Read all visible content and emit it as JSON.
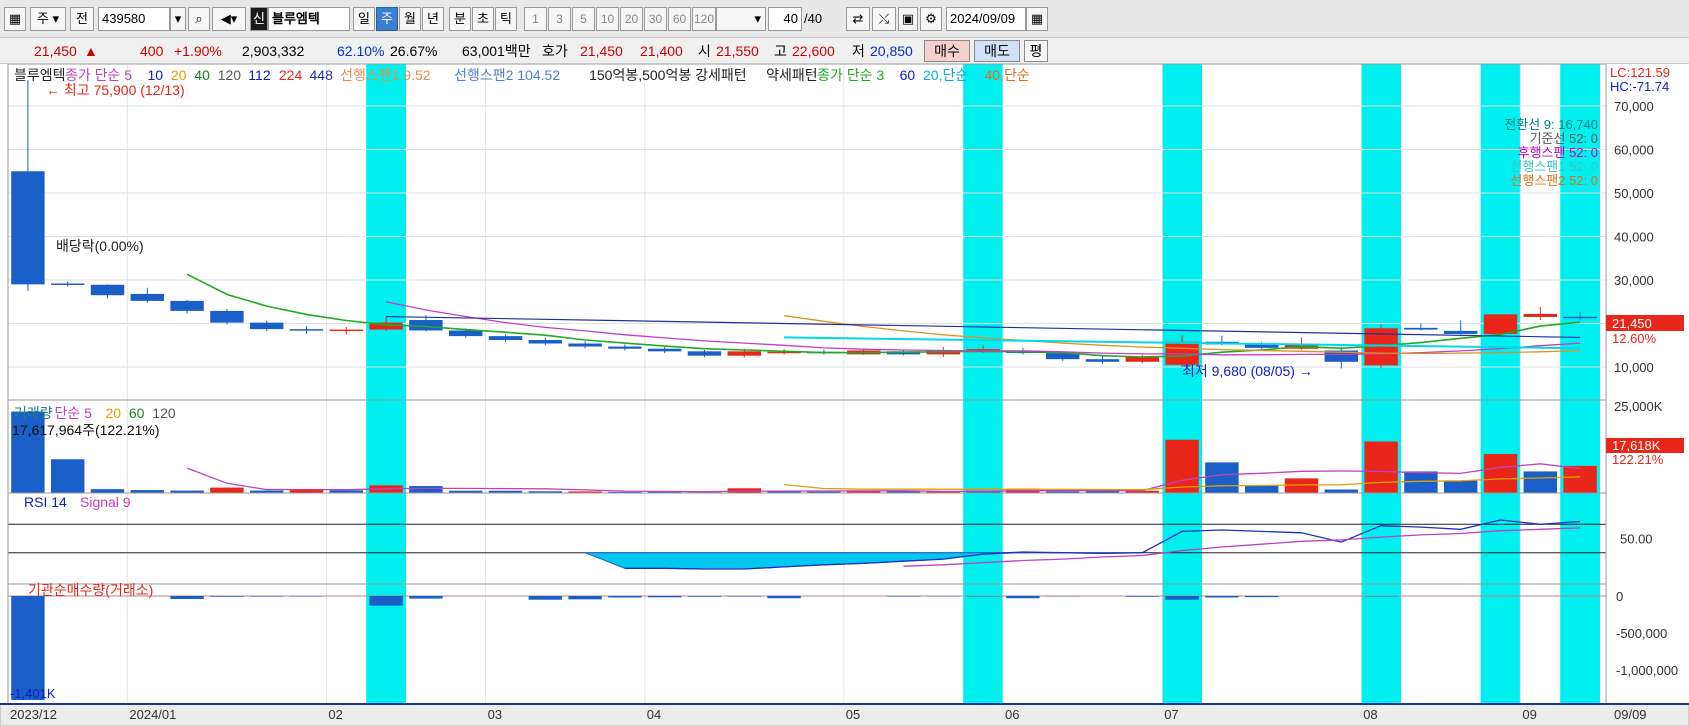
{
  "toolbar": {
    "period_selected": "주",
    "prev_label": "전",
    "stock_code": "439580",
    "stock_type_badge": "신",
    "stock_name": "블루엠텍",
    "day_label": "일",
    "week_label": "주",
    "month_label": "월",
    "year_label": "년",
    "minute_label": "분",
    "second_label": "초",
    "tick_label": "틱",
    "intervals": [
      "1",
      "3",
      "5",
      "10",
      "20",
      "30",
      "60",
      "120"
    ],
    "count_display": "40",
    "count_total": "/40",
    "date": "2024/09/09"
  },
  "quote": {
    "price": "21,450",
    "change": "400",
    "change_pct": "+1.90%",
    "volume": "2,903,332",
    "volume_pct": "62.10%",
    "turnover_pct": "26.67%",
    "value": "63,001백만",
    "ask_label": "호가",
    "ask": "21,450",
    "bid": "21,400",
    "open_label": "시",
    "open": "21,550",
    "high_label": "고",
    "high": "22,600",
    "low_label": "저",
    "low": "20,850",
    "buy_button": "매수",
    "sell_button": "매도",
    "eval_button": "평"
  },
  "chart_data": [
    {
      "type": "candlestick",
      "stock_name": "블루엠텍",
      "legend": [
        "블루엠텍",
        "종가 단순 5",
        "10",
        "20",
        "40",
        "120",
        "112",
        "224",
        "448",
        "선행스팬1 9.52",
        "선행스팬2 104.52",
        "150억봉,500억봉 강세패턴",
        "약세패턴",
        "종가 단순 3",
        "60",
        "20,단순",
        "40,단순"
      ],
      "candles": [
        {
          "date": "2023/12/11",
          "o": 55000,
          "h": 75900,
          "l": 27500,
          "c": 29000
        },
        {
          "date": "2023/12/18",
          "o": 29200,
          "h": 29600,
          "l": 28500,
          "c": 28900
        },
        {
          "date": "2023/12/25",
          "o": 28900,
          "h": 29000,
          "l": 25800,
          "c": 26500
        },
        {
          "date": "2024/01/01",
          "o": 26800,
          "h": 28200,
          "l": 24800,
          "c": 25200
        },
        {
          "date": "2024/01/08",
          "o": 25200,
          "h": 25400,
          "l": 22300,
          "c": 22900
        },
        {
          "date": "2024/01/15",
          "o": 22900,
          "h": 23300,
          "l": 19800,
          "c": 20200
        },
        {
          "date": "2024/01/22",
          "o": 20200,
          "h": 20600,
          "l": 18300,
          "c": 18700
        },
        {
          "date": "2024/01/29",
          "o": 18700,
          "h": 19400,
          "l": 17600,
          "c": 18600
        },
        {
          "date": "2024/02/05",
          "o": 18600,
          "h": 19200,
          "l": 17500,
          "c": 18600
        },
        {
          "date": "2024/02/13",
          "o": 18600,
          "h": 21600,
          "l": 18300,
          "c": 20200
        },
        {
          "date": "2024/02/19",
          "o": 20800,
          "h": 21900,
          "l": 18200,
          "c": 18400
        },
        {
          "date": "2024/02/26",
          "o": 18400,
          "h": 18900,
          "l": 16700,
          "c": 17100
        },
        {
          "date": "2024/03/04",
          "o": 17100,
          "h": 17500,
          "l": 15800,
          "c": 16200
        },
        {
          "date": "2024/03/11",
          "o": 16200,
          "h": 16700,
          "l": 15000,
          "c": 15400
        },
        {
          "date": "2024/03/18",
          "o": 15400,
          "h": 15900,
          "l": 14300,
          "c": 14700
        },
        {
          "date": "2024/03/25",
          "o": 14700,
          "h": 15200,
          "l": 13800,
          "c": 14200
        },
        {
          "date": "2024/04/01",
          "o": 14200,
          "h": 14600,
          "l": 13200,
          "c": 13600
        },
        {
          "date": "2024/04/08",
          "o": 13600,
          "h": 13900,
          "l": 12300,
          "c": 12600
        },
        {
          "date": "2024/04/15",
          "o": 12600,
          "h": 14200,
          "l": 12200,
          "c": 13600
        },
        {
          "date": "2024/04/22",
          "o": 13400,
          "h": 14100,
          "l": 12900,
          "c": 13500
        },
        {
          "date": "2024/04/29",
          "o": 13500,
          "h": 14000,
          "l": 12900,
          "c": 13200
        },
        {
          "date": "2024/05/06",
          "o": 12900,
          "h": 14200,
          "l": 12800,
          "c": 13800
        },
        {
          "date": "2024/05/13",
          "o": 13600,
          "h": 14000,
          "l": 12700,
          "c": 12900
        },
        {
          "date": "2024/05/20",
          "o": 12900,
          "h": 14600,
          "l": 12300,
          "c": 13900
        },
        {
          "date": "2024/05/27",
          "o": 13900,
          "h": 15000,
          "l": 13200,
          "c": 14100
        },
        {
          "date": "2024/06/03",
          "o": 13800,
          "h": 14400,
          "l": 12900,
          "c": 13200
        },
        {
          "date": "2024/06/10",
          "o": 13200,
          "h": 13600,
          "l": 11400,
          "c": 11800
        },
        {
          "date": "2024/06/17",
          "o": 11800,
          "h": 12400,
          "l": 10800,
          "c": 11200
        },
        {
          "date": "2024/06/24",
          "o": 11200,
          "h": 12800,
          "l": 10900,
          "c": 12400
        },
        {
          "date": "2024/07/01",
          "o": 10500,
          "h": 17300,
          "l": 10000,
          "c": 15800
        },
        {
          "date": "2024/07/08",
          "o": 15800,
          "h": 17200,
          "l": 15000,
          "c": 15200
        },
        {
          "date": "2024/07/15",
          "o": 15200,
          "h": 15800,
          "l": 14100,
          "c": 14400
        },
        {
          "date": "2024/07/22",
          "o": 14200,
          "h": 16800,
          "l": 14000,
          "c": 15100
        },
        {
          "date": "2024/07/29",
          "o": 13800,
          "h": 14600,
          "l": 9680,
          "c": 11200
        },
        {
          "date": "2024/08/05",
          "o": 10400,
          "h": 19800,
          "l": 9680,
          "c": 18900
        },
        {
          "date": "2024/08/12",
          "o": 19000,
          "h": 20000,
          "l": 18400,
          "c": 18600
        },
        {
          "date": "2024/08/19",
          "o": 18300,
          "h": 20700,
          "l": 17400,
          "c": 17600
        },
        {
          "date": "2024/08/26",
          "o": 17600,
          "h": 22100,
          "l": 17400,
          "c": 22100
        },
        {
          "date": "2024/09/02",
          "o": 21500,
          "h": 23800,
          "l": 20800,
          "c": 22200
        },
        {
          "date": "2024/09/09",
          "o": 21550,
          "h": 22600,
          "l": 20850,
          "c": 21450
        }
      ],
      "ma5": [
        null,
        null,
        null,
        null,
        31300,
        26700,
        24000,
        22100,
        20700,
        19700,
        19300,
        18600,
        18000,
        17300,
        16200,
        15500,
        14800,
        14200,
        13900,
        13600,
        13300,
        13300,
        13400,
        13500,
        13600,
        13500,
        13300,
        12600,
        12300,
        12500,
        13400,
        13900,
        14700,
        14300,
        14900,
        15600,
        16600,
        17500,
        19400,
        20300
      ],
      "ma10": [
        null,
        null,
        null,
        null,
        null,
        null,
        null,
        null,
        null,
        25000,
        23100,
        21600,
        20200,
        19100,
        18300,
        17400,
        16700,
        16000,
        15500,
        15000,
        14400,
        14100,
        13900,
        13800,
        13700,
        13700,
        13500,
        13200,
        13000,
        13000,
        12800,
        12800,
        12900,
        12900,
        13000,
        13300,
        13700,
        14200,
        14900,
        15500
      ],
      "ma20": [
        null,
        null,
        null,
        null,
        null,
        null,
        null,
        null,
        null,
        null,
        null,
        null,
        null,
        null,
        null,
        null,
        null,
        null,
        null,
        21800,
        20500,
        19300,
        18300,
        17400,
        16700,
        16100,
        15500,
        15000,
        14600,
        14300,
        14000,
        13800,
        13600,
        13400,
        13200,
        13100,
        13200,
        13300,
        13500,
        13800
      ],
      "ma40": [
        null,
        null,
        null,
        null,
        null,
        null,
        null,
        null,
        null,
        null,
        null,
        null,
        null,
        null,
        null,
        null,
        null,
        null,
        null,
        null,
        null,
        null,
        null,
        null,
        null,
        null,
        null,
        null,
        null,
        null,
        null,
        null,
        null,
        null,
        null,
        null,
        null,
        null,
        null,
        17300
      ],
      "trendline": {
        "from_idx": 9,
        "from": 21600,
        "to_idx": 39,
        "to": 16800
      },
      "span_line": {
        "from_idx": 19,
        "from": 16800,
        "to_idx": 39,
        "to": 14300
      },
      "highlight_weeks": [
        9,
        24,
        29,
        34,
        37,
        39
      ],
      "y_ticks": [
        10000,
        20000,
        30000,
        40000,
        50000,
        60000,
        70000
      ],
      "y_tick_labels": [
        "10,000",
        "20,000",
        "30,000",
        "40,000",
        "50,000",
        "60,000",
        "70,000"
      ],
      "x_labels": [
        {
          "idx": 0,
          "text": "2023/12"
        },
        {
          "idx": 3,
          "text": "2024/01"
        },
        {
          "idx": 8,
          "text": "02"
        },
        {
          "idx": 12,
          "text": "03"
        },
        {
          "idx": 16,
          "text": "04"
        },
        {
          "idx": 21,
          "text": "05"
        },
        {
          "idx": 25,
          "text": "06"
        },
        {
          "idx": 29,
          "text": "07"
        },
        {
          "idx": 34,
          "text": "08"
        },
        {
          "idx": 38,
          "text": "09"
        }
      ],
      "x_right_label": "09/09",
      "annotations": {
        "high": "최고 75,900 (12/13)",
        "low": "최저 9,680 (08/05)",
        "dividend": "배당락(0.00%)",
        "lc": "LC:121.59",
        "hc": "HC:-71.74",
        "ichimoku": [
          "전환선 9: 16,740",
          "기준선 52: 0",
          "후행스팬 52: 0",
          "선행스팬1 52: 0",
          "선행스팬2 52: 0"
        ],
        "last_price_tag": "21,450",
        "last_pct_tag": "12.60%"
      }
    },
    {
      "type": "bar",
      "title": "거래량",
      "legend": [
        "거래량",
        "단순 5",
        "20",
        "60",
        "120"
      ],
      "values_k": [
        23400,
        9700,
        1100,
        850,
        700,
        1550,
        700,
        950,
        750,
        2200,
        2000,
        650,
        650,
        500,
        450,
        300,
        350,
        250,
        1350,
        450,
        400,
        450,
        500,
        550,
        600,
        1250,
        450,
        550,
        650,
        15300,
        8800,
        2300,
        4200,
        1000,
        14800,
        6200,
        3600,
        11200,
        6200,
        7800
      ],
      "up": [
        false,
        false,
        false,
        false,
        false,
        true,
        false,
        true,
        false,
        true,
        false,
        false,
        false,
        false,
        true,
        false,
        false,
        false,
        true,
        false,
        false,
        true,
        false,
        true,
        false,
        true,
        false,
        false,
        true,
        true,
        false,
        false,
        true,
        false,
        true,
        false,
        false,
        true,
        false,
        true
      ],
      "ma5_k": [
        null,
        null,
        null,
        null,
        7150,
        2780,
        980,
        1010,
        930,
        1230,
        1320,
        1310,
        1250,
        1200,
        890,
        520,
        450,
        370,
        550,
        540,
        570,
        590,
        630,
        470,
        500,
        670,
        670,
        680,
        700,
        3640,
        5250,
        5650,
        6250,
        6330,
        6220,
        5820,
        5620,
        7360,
        8400,
        7000
      ],
      "ma20_k": [
        null,
        null,
        null,
        null,
        null,
        null,
        null,
        null,
        null,
        null,
        null,
        null,
        null,
        null,
        null,
        null,
        null,
        null,
        null,
        2420,
        1280,
        1090,
        1090,
        1080,
        1050,
        1040,
        1030,
        1010,
        990,
        1710,
        2070,
        2150,
        2330,
        2360,
        3060,
        3350,
        3500,
        4040,
        4320,
        4650
      ],
      "y_ticks_k": [
        25000
      ],
      "y_tick_labels": [
        "25,000K"
      ],
      "current_label": "17,617,964주(122.21%)",
      "tag_value": "17,618K",
      "tag_pct": "122.21%"
    },
    {
      "type": "line",
      "title": "RSI 14",
      "legend": [
        "RSI 14",
        "Signal 9"
      ],
      "rsi": [
        null,
        null,
        null,
        null,
        null,
        null,
        null,
        null,
        null,
        null,
        null,
        null,
        null,
        null,
        null,
        8,
        8,
        7,
        7,
        10,
        13,
        15,
        18,
        21,
        28,
        31,
        30,
        29,
        30,
        60,
        62,
        60,
        58,
        45,
        68,
        66,
        63,
        76,
        70,
        74
      ],
      "signal": [
        null,
        null,
        null,
        null,
        null,
        null,
        null,
        null,
        null,
        null,
        null,
        null,
        null,
        null,
        null,
        null,
        null,
        null,
        null,
        null,
        null,
        null,
        11,
        13,
        16,
        19,
        21,
        24,
        26,
        33,
        38,
        42,
        46,
        48,
        52,
        55,
        57,
        61,
        63,
        65
      ],
      "fill_range": {
        "from_idx": 14,
        "to_idx": 28
      },
      "fill_top": 30,
      "y_tick_labels": [
        "50.00"
      ]
    },
    {
      "type": "bar",
      "title": "기관순매수량(거래소)",
      "values_k": [
        -1401,
        0,
        0,
        0,
        -40,
        -10,
        -8,
        -6,
        0,
        -130,
        -35,
        0,
        0,
        -50,
        -45,
        -20,
        -18,
        -10,
        -8,
        -30,
        0,
        0,
        -8,
        -5,
        -5,
        -30,
        -4,
        0,
        -10,
        -50,
        -20,
        -15,
        0,
        0,
        -5,
        0,
        0,
        0,
        0,
        0
      ],
      "y_ticks_k": [
        0,
        -500,
        -1000
      ],
      "y_tick_labels": [
        "0",
        "-500,000",
        "-1,000,000"
      ],
      "min_label": "-1,401K"
    }
  ]
}
